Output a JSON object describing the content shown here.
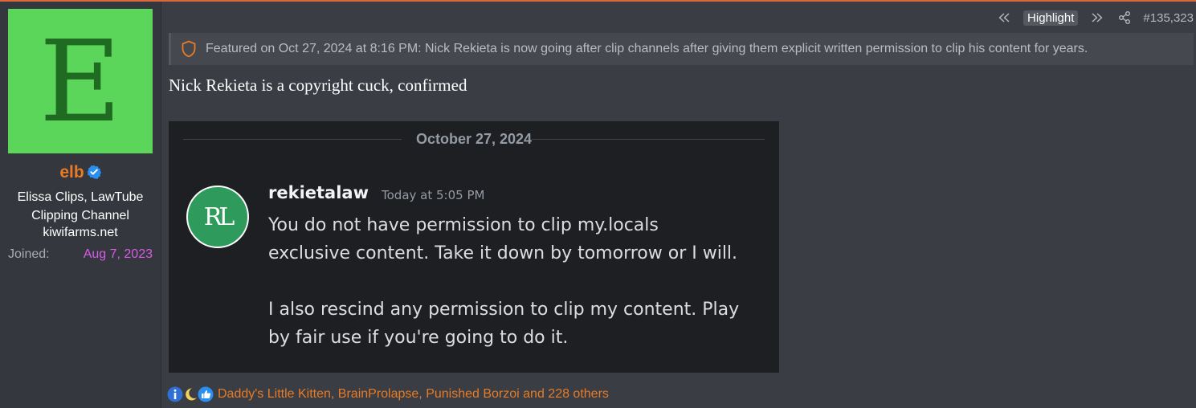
{
  "user": {
    "avatar_letter": "E",
    "avatar_color": "#5cd65a",
    "username": "elb",
    "title": "Elissa Clips, LawTube Clipping Channel",
    "site": "kiwifarms.net",
    "joined_label": "Joined:",
    "joined_value": "Aug 7, 2023"
  },
  "post_header": {
    "highlight_label": "Highlight",
    "post_number": "#135,323"
  },
  "featured": {
    "text": "Featured on Oct 27, 2024 at 8:16 PM: Nick Rekieta is now going after clip channels after giving them explicit written permission to clip his content for years."
  },
  "post": {
    "text": "Nick Rekieta is a copyright cuck, confirmed"
  },
  "embed": {
    "date": "October 27, 2024",
    "avatar_text": "RL",
    "author": "rekietalaw",
    "timestamp": "Today at 5:05 PM",
    "message": "You do not have permission to clip my.locals\nexclusive content.  Take it down by tomorrow or I will.\n\nI also rescind any permission to clip my content.  Play\nby fair use if you're going to do it."
  },
  "reactions": {
    "icons": [
      "info-icon",
      "moon-icon",
      "thumbs-up-icon"
    ],
    "text": "Daddy's Little Kitten, BrainProlapse, Punished Borzoi and 228 others"
  },
  "colors": {
    "accent": "#e87b24",
    "joined_date": "#d95ae8",
    "background": "#3a3d44"
  }
}
